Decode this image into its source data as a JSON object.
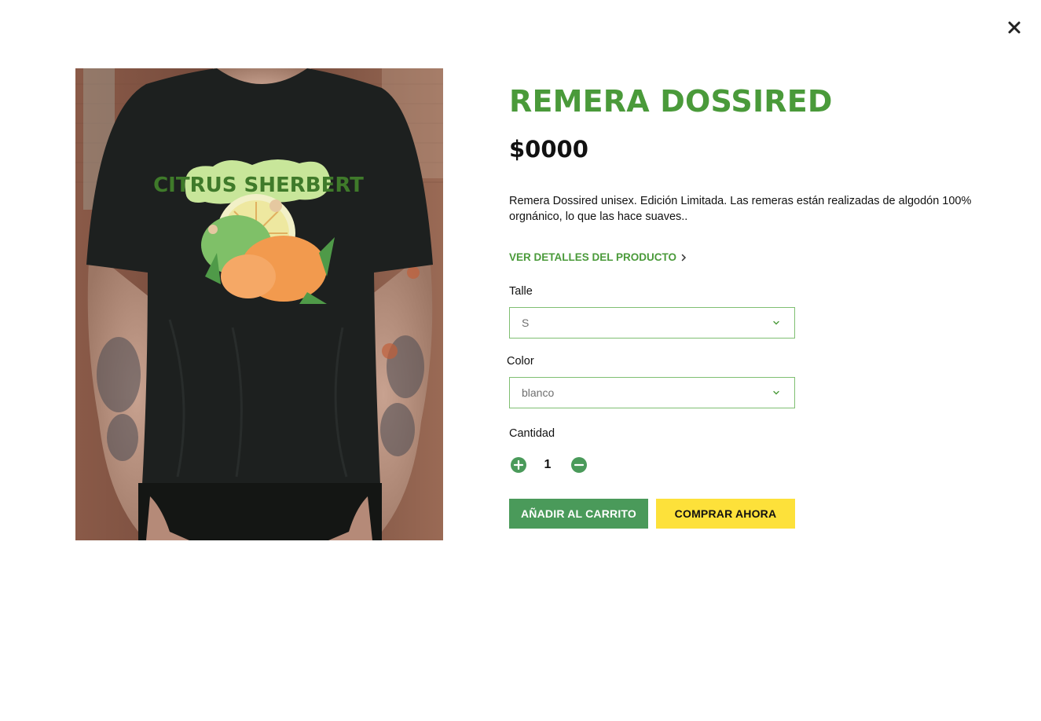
{
  "modal": {
    "close_icon": "close-icon"
  },
  "product": {
    "title": "REMERA DOSSIRED",
    "price": "$0000",
    "description": "Remera Dossired unisex. Edición Limitada. Las remeras están realizadas de algodón 100% orgnánico, lo que las hace suaves..",
    "details_link": "VER DETALLES DEL PRODUCTO",
    "image_alt": "Remera negra con estampa Citrus Sherbert"
  },
  "options": {
    "size_label": "Talle",
    "size_value": "S",
    "color_label": "Color",
    "color_value": "blanco"
  },
  "quantity": {
    "label": "Cantidad",
    "value": "1"
  },
  "actions": {
    "add_to_cart": "AÑADIR AL CARRITO",
    "buy_now": "COMPRAR AHORA"
  },
  "colors": {
    "accent_green": "#4a9a3a",
    "cart_button": "#4a9a5a",
    "buy_button": "#fde13a",
    "select_border": "#7fbf72"
  }
}
